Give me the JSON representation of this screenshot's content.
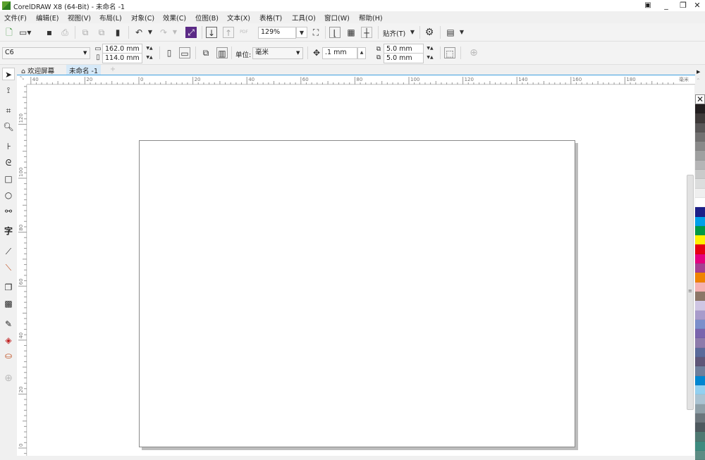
{
  "window": {
    "title": "CorelDRAW X8 (64-Bit) - 未命名 -1",
    "minimize": "_",
    "restore": "❐",
    "close": "✕"
  },
  "menu": [
    "文件(F)",
    "编辑(E)",
    "视图(V)",
    "布局(L)",
    "对象(C)",
    "效果(C)",
    "位图(B)",
    "文本(X)",
    "表格(T)",
    "工具(O)",
    "窗口(W)",
    "帮助(H)"
  ],
  "toolbar": {
    "zoom": "129%",
    "snap": "贴齐(T)",
    "pdf": "PDF"
  },
  "property_bar": {
    "page_size": "C6",
    "width": "162.0 mm",
    "height": "114.0 mm",
    "unit_label": "单位:",
    "unit": "毫米",
    "nudge": ".1 mm",
    "dup_x": "5.0 mm",
    "dup_y": "5.0 mm"
  },
  "tabs": [
    {
      "label": "欢迎屏幕",
      "active": false
    },
    {
      "label": "未命名 -1",
      "active": true
    }
  ],
  "ruler": {
    "h_labels": [
      "40",
      "20",
      "0",
      "20",
      "40",
      "60",
      "80",
      "100",
      "120",
      "140",
      "160",
      "180"
    ],
    "v_labels": [
      "120",
      "100",
      "80",
      "60",
      "40",
      "20",
      "0"
    ],
    "unit": "毫米"
  },
  "palette": [
    "#231f20",
    "#3e3a39",
    "#595757",
    "#727171",
    "#898989",
    "#9fa0a0",
    "#b5b5b6",
    "#c9caca",
    "#dcdddd",
    "#efefef",
    "#ffffff",
    "#1d2088",
    "#00a0e9",
    "#009944",
    "#fff100",
    "#e60012",
    "#e4007f",
    "#a53f92",
    "#f08300",
    "#f5b2b2",
    "#8c7667",
    "#cfc6e4",
    "#a89bcb",
    "#7b8fcb",
    "#7a65ad",
    "#8d7bab",
    "#5a6a9a",
    "#5f5678",
    "#6e7f9c",
    "#0086d1",
    "#93d0f0",
    "#aac3d2",
    "#8fa0a8",
    "#6c767c",
    "#4e595e",
    "#4f7871",
    "#3e8b7f",
    "#5d8c84"
  ]
}
